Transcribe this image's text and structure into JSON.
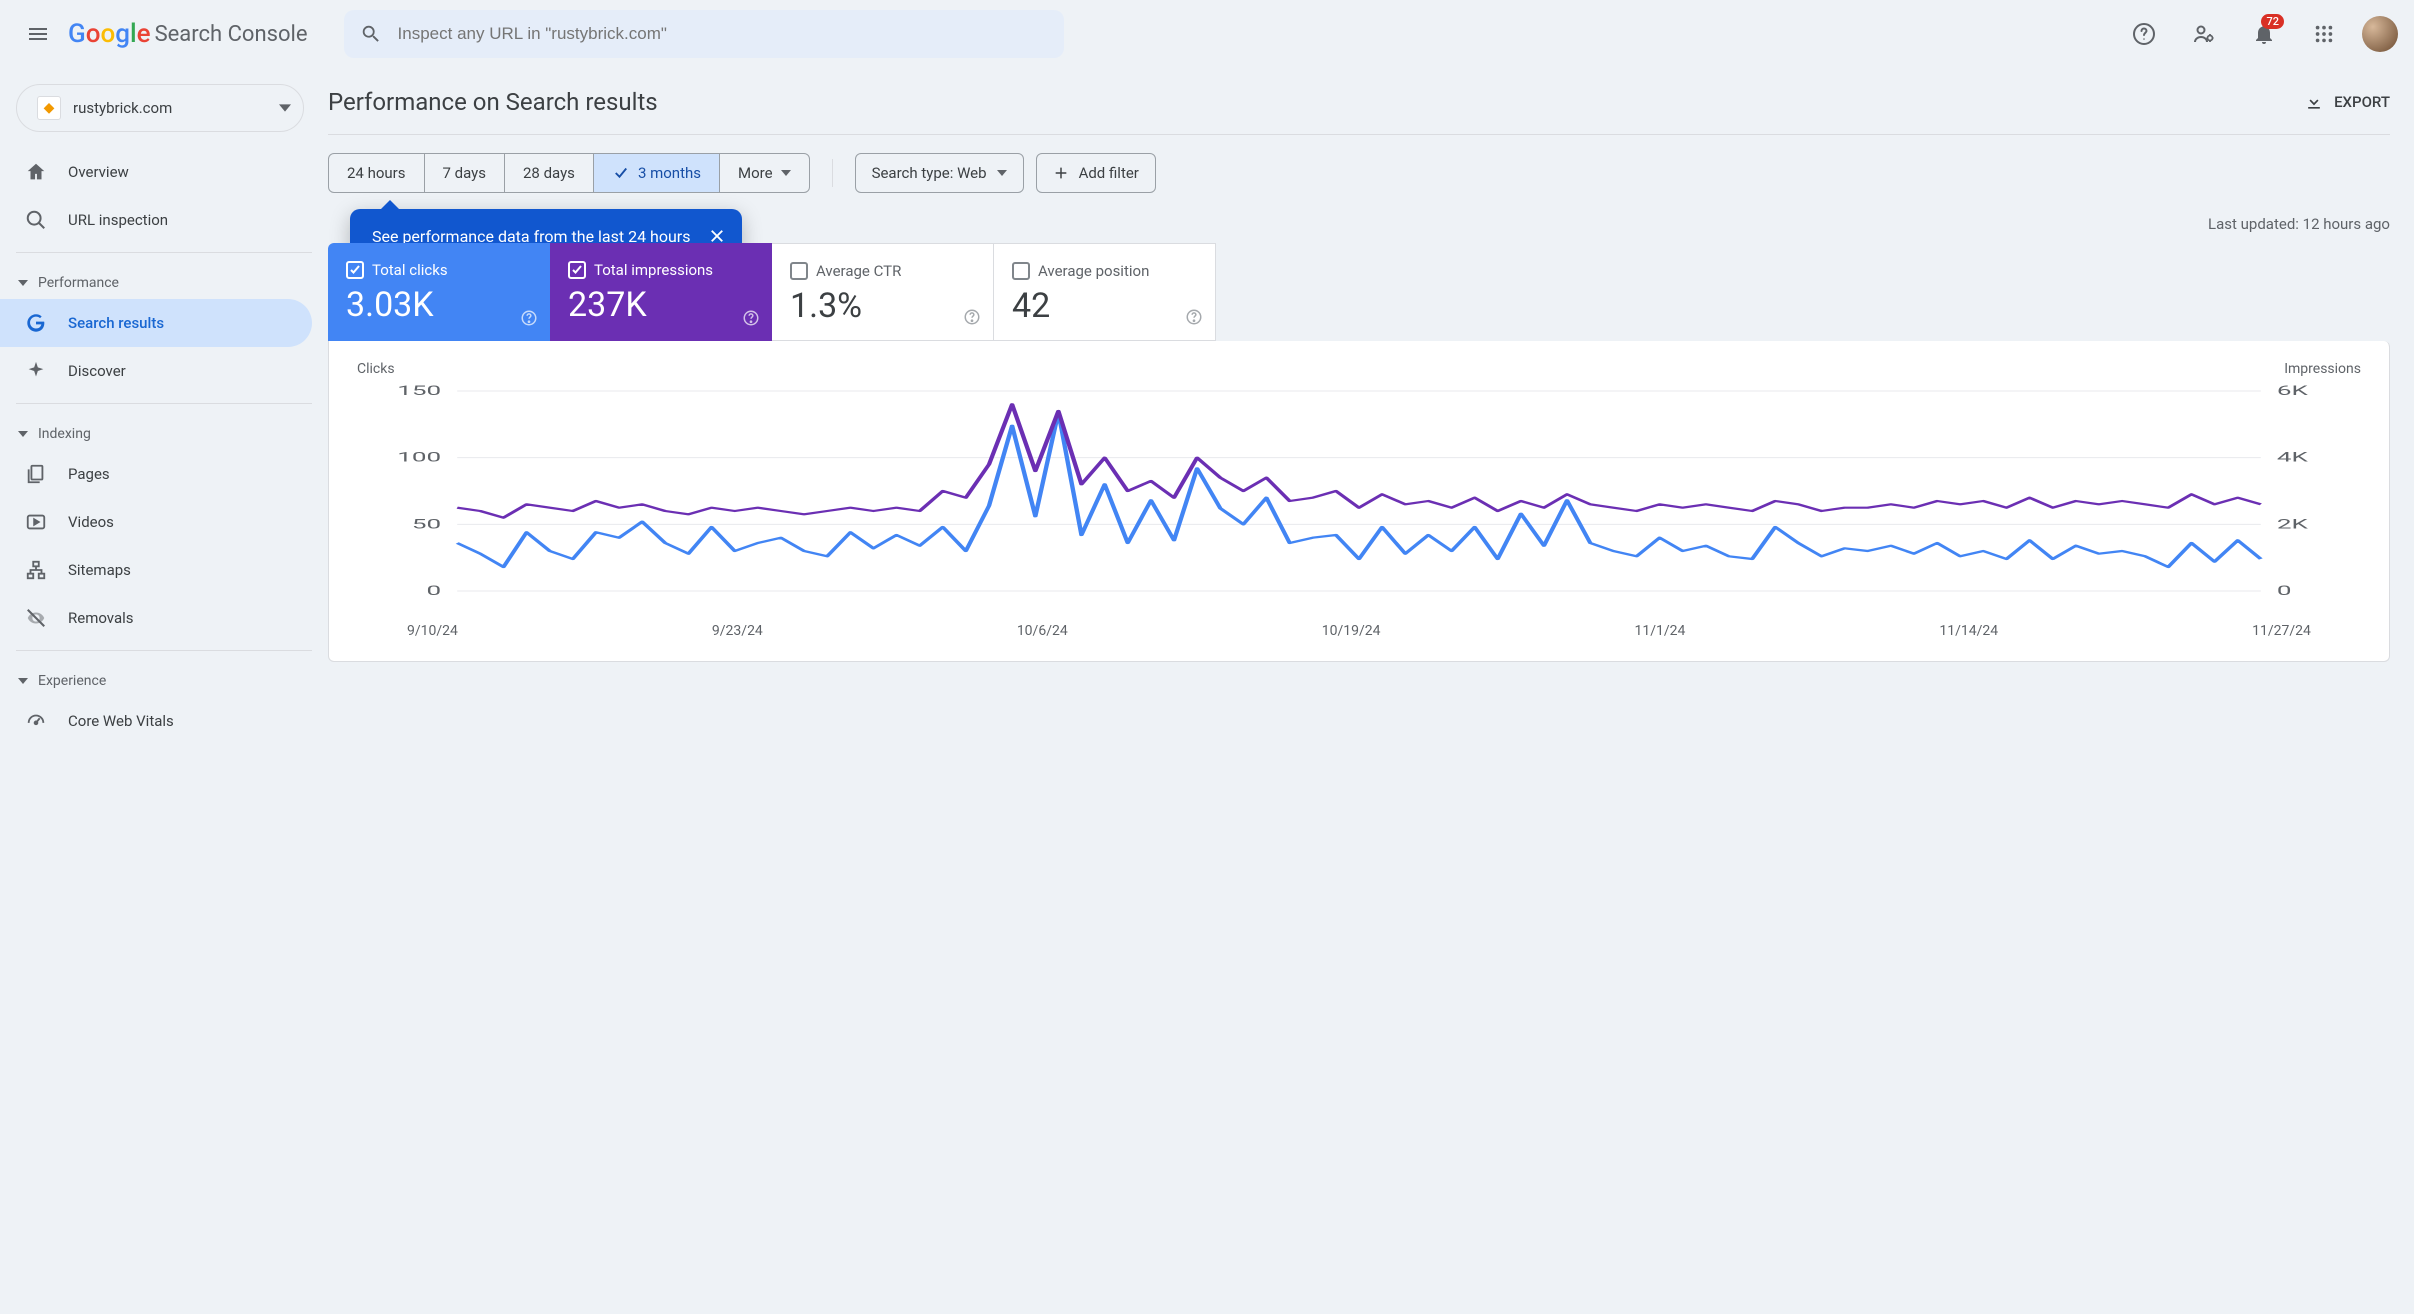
{
  "header": {
    "product_name": "Search Console",
    "search_placeholder": "Inspect any URL in \"rustybrick.com\"",
    "notification_count": "72"
  },
  "sidebar": {
    "property": "rustybrick.com",
    "nav_overview": "Overview",
    "nav_url_inspection": "URL inspection",
    "section_performance": "Performance",
    "nav_search_results": "Search results",
    "nav_discover": "Discover",
    "section_indexing": "Indexing",
    "nav_pages": "Pages",
    "nav_videos": "Videos",
    "nav_sitemaps": "Sitemaps",
    "nav_removals": "Removals",
    "section_experience": "Experience",
    "nav_core_web_vitals": "Core Web Vitals"
  },
  "page": {
    "title": "Performance on Search results",
    "export": "EXPORT",
    "last_updated": "Last updated: 12 hours ago"
  },
  "filters": {
    "range_24h": "24 hours",
    "range_7d": "7 days",
    "range_28d": "28 days",
    "range_3m": "3 months",
    "more": "More",
    "search_type": "Search type: Web",
    "add_filter": "Add filter",
    "callout_text": "See performance data from the last 24 hours"
  },
  "metrics": {
    "clicks_label": "Total clicks",
    "clicks_value": "3.03K",
    "impressions_label": "Total impressions",
    "impressions_value": "237K",
    "ctr_label": "Average CTR",
    "ctr_value": "1.3%",
    "position_label": "Average position",
    "position_value": "42"
  },
  "chart": {
    "left_axis": "Clicks",
    "right_axis": "Impressions",
    "y_left": [
      "150",
      "100",
      "50",
      "0"
    ],
    "y_right": [
      "6K",
      "4K",
      "2K",
      "0"
    ],
    "x_labels": [
      "9/10/24",
      "9/23/24",
      "10/6/24",
      "10/19/24",
      "11/1/24",
      "11/14/24",
      "11/27/24"
    ]
  },
  "chart_data": {
    "type": "line",
    "xlabel": "",
    "x_ticks": [
      "9/10/24",
      "9/23/24",
      "10/6/24",
      "10/19/24",
      "11/1/24",
      "11/14/24",
      "11/27/24"
    ],
    "series": [
      {
        "name": "Clicks",
        "axis": "left",
        "ylim": [
          0,
          150
        ],
        "values": [
          36,
          28,
          18,
          44,
          30,
          24,
          44,
          40,
          52,
          36,
          28,
          48,
          30,
          36,
          40,
          30,
          26,
          44,
          32,
          42,
          34,
          48,
          30,
          64,
          124,
          56,
          134,
          42,
          80,
          36,
          68,
          38,
          92,
          62,
          50,
          70,
          36,
          40,
          42,
          24,
          48,
          28,
          42,
          30,
          48,
          24,
          58,
          34,
          68,
          36,
          30,
          26,
          40,
          30,
          34,
          26,
          24,
          48,
          36,
          26,
          32,
          30,
          34,
          28,
          36,
          26,
          30,
          24,
          38,
          24,
          34,
          28,
          30,
          26,
          18,
          36,
          22,
          38,
          24
        ]
      },
      {
        "name": "Impressions",
        "axis": "right",
        "ylim": [
          0,
          6000
        ],
        "values": [
          2500,
          2400,
          2200,
          2600,
          2500,
          2400,
          2700,
          2500,
          2600,
          2400,
          2300,
          2500,
          2400,
          2500,
          2400,
          2300,
          2400,
          2500,
          2400,
          2500,
          2400,
          3000,
          2800,
          3800,
          5600,
          3600,
          5400,
          3200,
          4000,
          3000,
          3300,
          2800,
          4000,
          3400,
          3000,
          3400,
          2700,
          2800,
          3000,
          2500,
          2900,
          2600,
          2700,
          2500,
          2800,
          2400,
          2700,
          2500,
          2900,
          2600,
          2500,
          2400,
          2600,
          2500,
          2600,
          2500,
          2400,
          2700,
          2600,
          2400,
          2500,
          2500,
          2600,
          2500,
          2700,
          2600,
          2700,
          2500,
          2800,
          2500,
          2700,
          2600,
          2700,
          2600,
          2500,
          2900,
          2600,
          2800,
          2600
        ]
      }
    ]
  }
}
